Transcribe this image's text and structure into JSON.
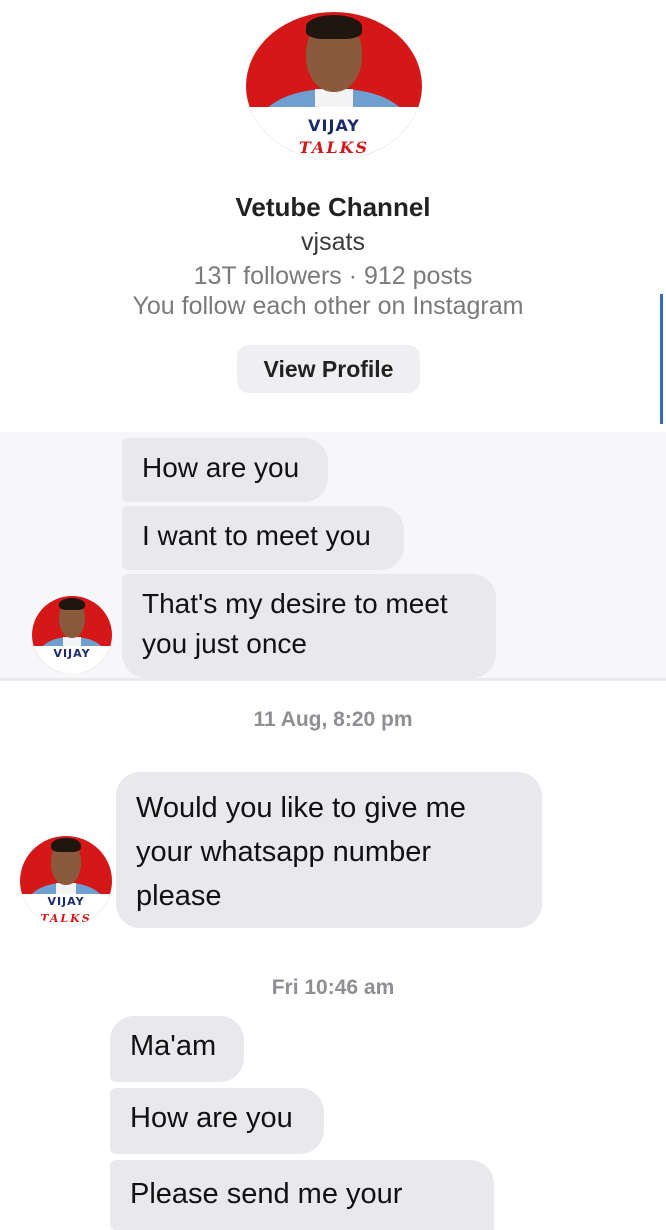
{
  "profile": {
    "avatar_text": "VIJAY",
    "avatar_subtext": "TALKS",
    "name": "Vetube Channel",
    "handle": "vjsats",
    "stats": "13T followers · 912 posts",
    "mutual_status": "You follow each other on Instagram",
    "view_profile_label": "View Profile"
  },
  "thread": {
    "group1": [
      "How are you",
      "I want to meet you",
      "That's my desire to meet\nyou just once"
    ],
    "timestamp1": "11 Aug, 8:20 pm",
    "group2": [
      "Would you like to give me\nyour whatsapp number\nplease"
    ],
    "timestamp2": "Fri 10:46 am",
    "group3": [
      "Ma'am",
      "How are you",
      "Please send me your"
    ]
  },
  "colors": {
    "bubble_incoming": "#e8e8ed",
    "avatar_background": "#d41818",
    "timestamp_text": "#8e8e93"
  }
}
